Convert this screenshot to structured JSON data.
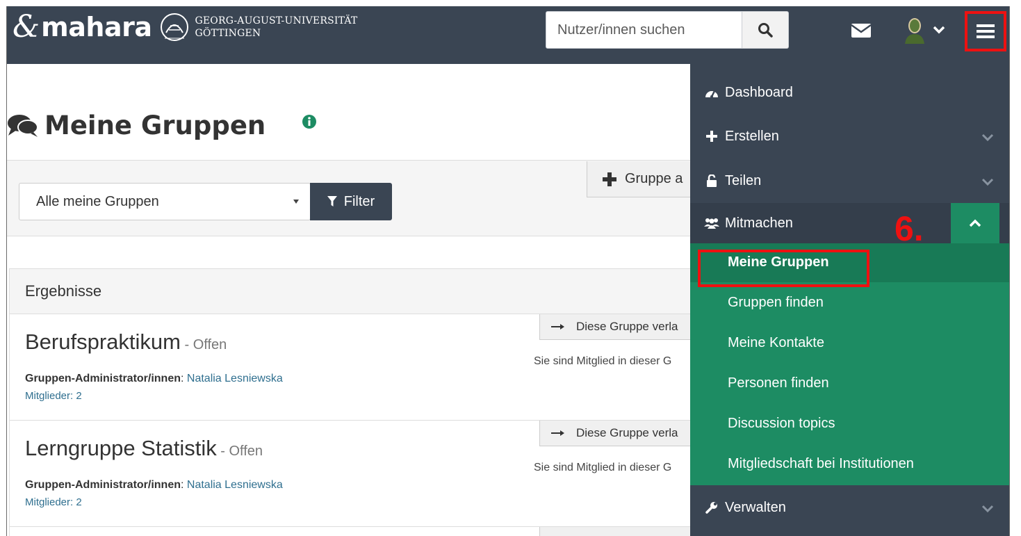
{
  "header": {
    "logo_text": "mahara",
    "university_line1": "GEORG-AUGUST-UNIVERSITÄT",
    "university_line2": "GÖTTINGEN",
    "search_placeholder": "Nutzer/innen suchen"
  },
  "page": {
    "title": "Meine Gruppen"
  },
  "filter": {
    "selected": "Alle meine Gruppen",
    "button_label": "Filter",
    "add_group_label": "Gruppe a"
  },
  "results": {
    "heading": "Ergebnisse",
    "groups": [
      {
        "name": "Berufspraktikum",
        "status": " - Offen",
        "admin_label": "Gruppen-Administrator/innen",
        "admin_sep": ": ",
        "admin_name": "Natalia Lesniewska",
        "members": "Mitglieder: 2",
        "leave_label": "Diese Gruppe verla",
        "member_note": "Sie sind Mitglied in dieser G"
      },
      {
        "name": "Lerngruppe Statistik",
        "status": " - Offen",
        "admin_label": "Gruppen-Administrator/innen",
        "admin_sep": ": ",
        "admin_name": "Natalia Lesniewska",
        "members": "Mitglieder: 2",
        "leave_label": "Diese Gruppe verla",
        "member_note": "Sie sind Mitglied in dieser G"
      }
    ]
  },
  "nav": {
    "items": [
      {
        "label": "Dashboard",
        "icon": "dashboard-icon"
      },
      {
        "label": "Erstellen",
        "icon": "plus-icon"
      },
      {
        "label": "Teilen",
        "icon": "unlock-icon"
      },
      {
        "label": "Mitmachen",
        "icon": "users-icon"
      },
      {
        "label": "Verwalten",
        "icon": "wrench-icon"
      }
    ],
    "submenu": [
      {
        "label": "Meine Gruppen",
        "active": true
      },
      {
        "label": "Gruppen finden"
      },
      {
        "label": "Meine Kontakte"
      },
      {
        "label": "Personen finden"
      },
      {
        "label": "Discussion topics"
      },
      {
        "label": "Mitgliedschaft bei Institutionen"
      }
    ]
  },
  "annotation": {
    "step_label": "6."
  },
  "colors": {
    "header_bg": "#3a4553",
    "submenu_bg": "#1d8c63",
    "highlight": "#ee1111",
    "link": "#2f6f8f"
  }
}
